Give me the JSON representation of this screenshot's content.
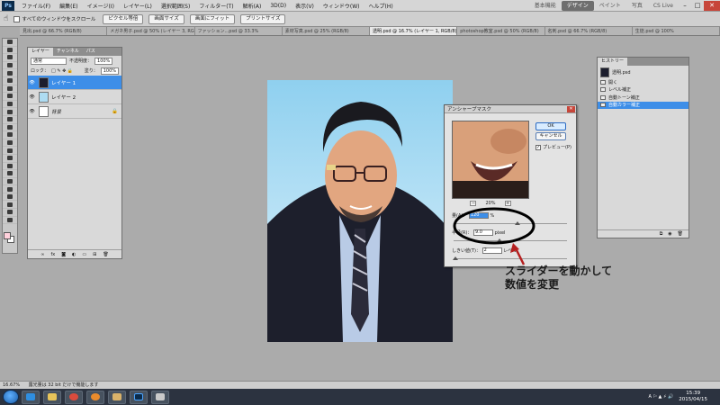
{
  "app": {
    "logo": "Ps"
  },
  "menu": [
    "ファイル(F)",
    "編集(E)",
    "イメージ(I)",
    "レイヤー(L)",
    "選択範囲(S)",
    "フィルター(T)",
    "解析(A)",
    "3D(D)",
    "表示(V)",
    "ウィンドウ(W)",
    "ヘルプ(H)"
  ],
  "workspace": {
    "items": [
      "基本機能",
      "デザイン",
      "ペイント",
      "写真"
    ],
    "active": "デザイン",
    "cslive": "CS Live"
  },
  "options": {
    "scroll_all_label": "すべてのウィンドウをスクロール",
    "buttons": [
      "ピクセル等倍",
      "画面サイズ",
      "画面にフィット",
      "プリントサイズ"
    ]
  },
  "tabs": [
    "見出.psd @ 66.7% (RGB/8)",
    "メガネ男子.psd @ 50% (レイヤー 3, RGB/8)",
    "ファッション...psd @ 33.3%",
    "素材写真.psd @ 25% (RGB/8)",
    "透明.psd @ 16.7% (レイヤー 1, RGB/8)",
    "photoshop教室.psd @ 50% (RGB/8)",
    "名刺.psd @ 66.7% (RGB/8)",
    "生徒.psd @ 100%"
  ],
  "active_tab": 4,
  "layers_panel": {
    "tabs": [
      "レイヤー",
      "チャンネル",
      "パス"
    ],
    "blend_mode": "通常",
    "opacity_label": "不透明度：",
    "opacity": "100%",
    "lock_label": "ロック：",
    "fill_label": "塗り：",
    "fill": "100%",
    "layers": [
      {
        "name": "レイヤー 1",
        "selected": true,
        "thumb_color": "#1c1e2e"
      },
      {
        "name": "レイヤー 2",
        "selected": false,
        "thumb_color": "#aedcf2"
      },
      {
        "name": "背景",
        "selected": false,
        "thumb_color": "#ffffff"
      }
    ]
  },
  "history_panel": {
    "tab": "ヒストリー",
    "snapshot": "透明.psd",
    "items": [
      {
        "name": "開く",
        "selected": false
      },
      {
        "name": "レベル補正",
        "selected": false
      },
      {
        "name": "自動トーン補正",
        "selected": false
      },
      {
        "name": "自動カラー補正",
        "selected": true
      }
    ]
  },
  "dialog": {
    "title": "アンシャープマスク",
    "ok": "OK",
    "cancel": "キャンセル",
    "preview_label": "プレビュー(P)",
    "zoom": "20%",
    "amount_label": "量(A)：",
    "amount_value": "120",
    "amount_unit": "%",
    "radius_label": "半径(R)：",
    "radius_value": "9.0",
    "radius_unit": "pixel",
    "threshold_label": "しきい値(T)：",
    "threshold_value": "2",
    "threshold_unit": "レベル"
  },
  "callout": {
    "line1": "スライダーを動かして",
    "line2": "数値を変更"
  },
  "status": {
    "zoom": "16.67%",
    "info": "露光量は 32 bit だけで機能します"
  },
  "taskbar": {
    "time": "15:39",
    "date": "2015/04/15",
    "apps": [
      "ie-icon",
      "explorer-icon",
      "chrome-icon",
      "firefox-icon",
      "folder-icon",
      "photoshop-icon",
      "app-icon"
    ]
  },
  "colors": {
    "selection": "#3d8ee8",
    "photo_bg": "#aedcf2",
    "foreground": "#ffd1dc"
  }
}
